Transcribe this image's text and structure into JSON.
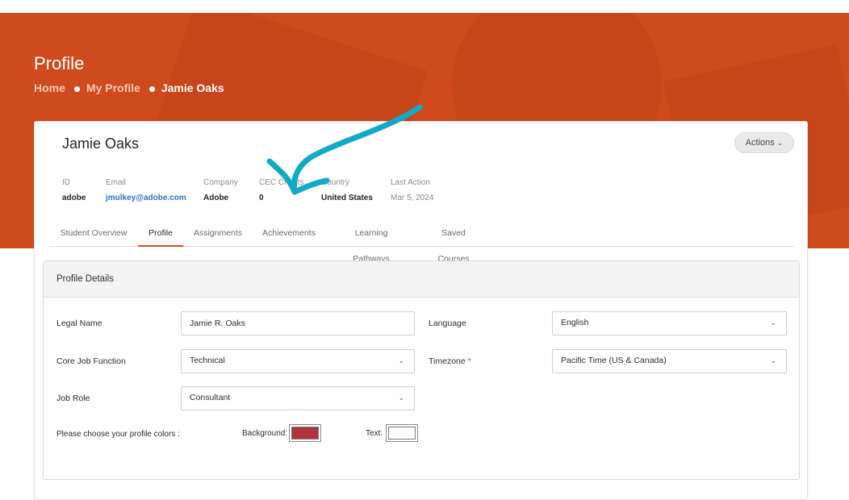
{
  "header": {
    "title": "Profile",
    "breadcrumb": [
      "Home",
      "My Profile",
      "Jamie Oaks"
    ]
  },
  "user": {
    "name": "Jamie Oaks",
    "actions_label": "Actions"
  },
  "meta": [
    {
      "label": "ID",
      "value": "adobe"
    },
    {
      "label": "Email",
      "value": "jmulkey@adobe.com"
    },
    {
      "label": "Company",
      "value": "Adobe"
    },
    {
      "label": "CEC Credits",
      "value": "0"
    },
    {
      "label": "Country",
      "value": "United States"
    },
    {
      "label": "Last Action",
      "value": "Mar 5, 2024"
    }
  ],
  "tabs": [
    {
      "label": "Student Overview",
      "active": false
    },
    {
      "label": "Profile",
      "active": true
    },
    {
      "label": "Assignments",
      "active": false
    },
    {
      "label": "Achievements",
      "active": false
    },
    {
      "label": "Learning Pathways",
      "active": false
    },
    {
      "label": "Saved Courses",
      "active": false
    }
  ],
  "profile_details": {
    "title": "Profile Details",
    "legal_name": {
      "label": "Legal Name",
      "value": "Jamie R. Oaks"
    },
    "language": {
      "label": "Language",
      "value": "English"
    },
    "core_job_function": {
      "label": "Core Job Function",
      "value": "Technical"
    },
    "timezone": {
      "label": "Timezone",
      "required_mark": "*",
      "value": "Pacific Time (US & Canada)"
    },
    "job_role": {
      "label": "Job Role",
      "value": "Consultant"
    },
    "colors": {
      "prompt": "Please choose your profile colors :",
      "background_label": "Background:",
      "background_color": "#b0343a",
      "text_label": "Text:",
      "text_color": "#ffffff"
    }
  },
  "theme": {
    "hero_color": "#cf4a1c",
    "active_tab_color": "#d64a24",
    "link_color": "#2d6fc4",
    "annotation_color": "#12a9c6"
  },
  "icons": {
    "dropdown": "chevron-down-icon",
    "breadcrumb_separator": "dot-icon",
    "annotation": "hand-drawn-arrow-icon"
  }
}
